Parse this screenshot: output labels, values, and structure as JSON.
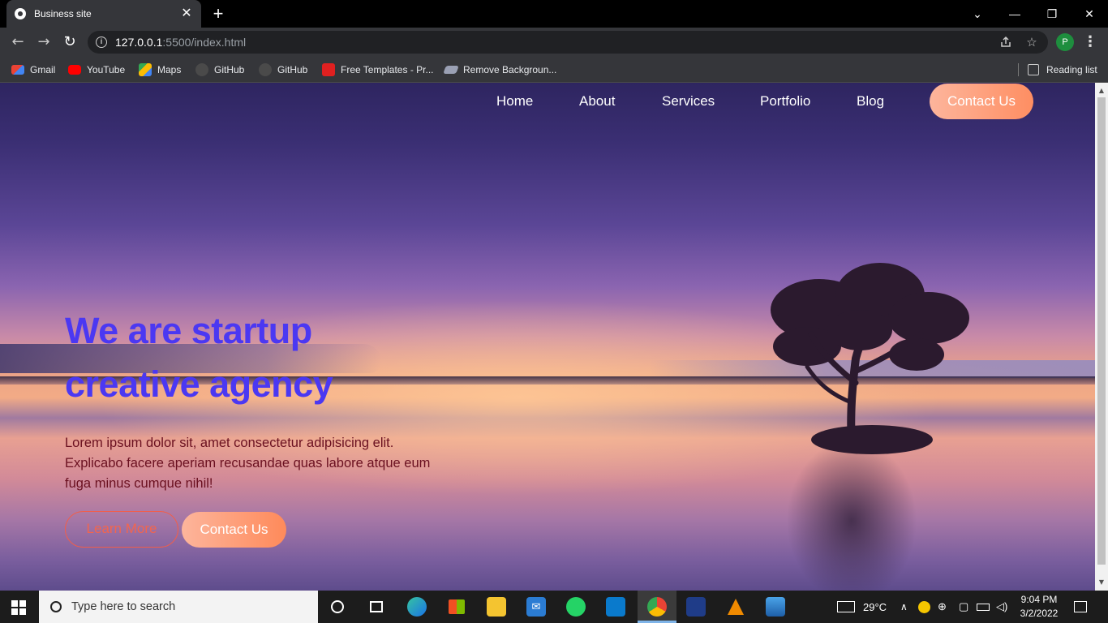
{
  "browser": {
    "tab_title": "Business site",
    "tab_close": "✕",
    "new_tab": "+",
    "url_host": "127.0.0.1",
    "url_path": ":5500/index.html",
    "profile_initial": "P",
    "window_controls": {
      "minimize": "—",
      "restore": "❐",
      "close": "✕",
      "tab_search": "⌄"
    },
    "nav_icons": {
      "back": "←",
      "forward": "→",
      "reload": "↻"
    },
    "bookmarks": [
      {
        "label": "Gmail",
        "icon": "gmail-icon",
        "color": "#ea4335"
      },
      {
        "label": "YouTube",
        "icon": "youtube-icon",
        "color": "#ff0000"
      },
      {
        "label": "Maps",
        "icon": "maps-icon",
        "color": "#34a853"
      },
      {
        "label": "GitHub",
        "icon": "github-icon",
        "color": "#444444"
      },
      {
        "label": "GitHub",
        "icon": "github-icon",
        "color": "#444444"
      },
      {
        "label": "Free Templates - Pr...",
        "icon": "template-icon",
        "color": "#e02020"
      },
      {
        "label": "Remove Backgroun...",
        "icon": "layers-icon",
        "color": "#9aa0b4"
      }
    ],
    "reading_list": "Reading list"
  },
  "page": {
    "nav": [
      {
        "label": "Home"
      },
      {
        "label": "About"
      },
      {
        "label": "Services"
      },
      {
        "label": "Portfolio"
      },
      {
        "label": "Blog"
      }
    ],
    "nav_cta": "Contact Us",
    "hero": {
      "title_line1": "We are startup",
      "title_line2": "creative agency",
      "text_line1": "Lorem ipsum dolor sit, amet consectetur adipisicing elit.",
      "text_line2": "Explicabo facere aperiam recusandae quas labore atque eum",
      "text_line3": "fuga minus cumque nihil!",
      "btn_secondary": "Learn More",
      "btn_primary": "Contact Us"
    },
    "colors": {
      "title": "#4b38f2",
      "accent_gradient_start": "#fdb59c",
      "accent_gradient_end": "#fe8e62",
      "outline": "#f25e4a",
      "body_text": "#6a1020"
    }
  },
  "taskbar": {
    "search_placeholder": "Type here to search",
    "weather": "29°C",
    "time": "9:04 PM",
    "date": "3/2/2022",
    "apps": [
      "cortana-icon",
      "task-view-icon",
      "edge-icon",
      "store-icon",
      "file-explorer-icon",
      "mail-icon",
      "whatsapp-icon",
      "vscode-icon",
      "chrome-icon",
      "security-icon",
      "vlc-icon",
      "photos-icon"
    ]
  }
}
